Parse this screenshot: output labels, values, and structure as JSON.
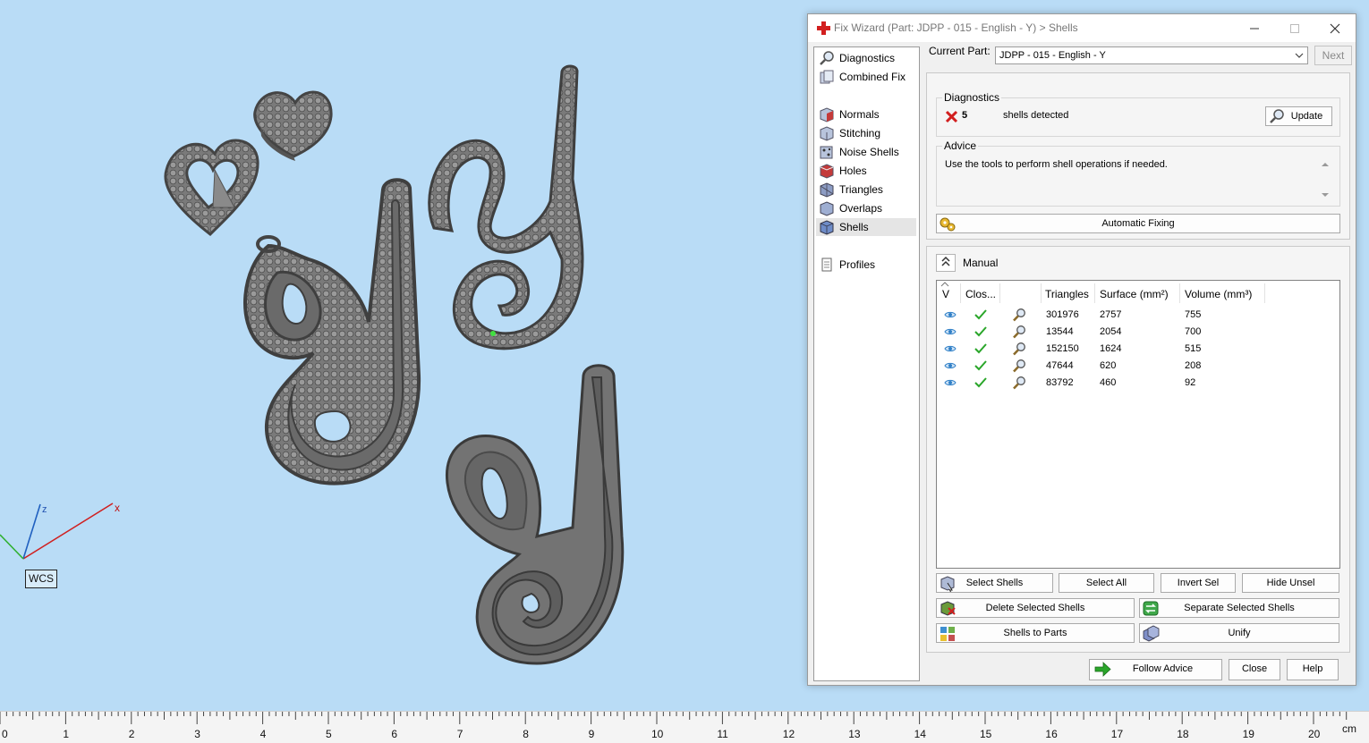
{
  "viewport": {
    "wcs_label": "WCS",
    "axis_x_label": "x",
    "axis_z_label": "z"
  },
  "ruler": {
    "ticks": [
      "0",
      "1",
      "2",
      "3",
      "4",
      "5",
      "6",
      "7",
      "8",
      "9",
      "10",
      "11",
      "12",
      "13",
      "14",
      "15",
      "16",
      "17",
      "18",
      "19",
      "20"
    ],
    "unit": "cm"
  },
  "dialog": {
    "title": "Fix Wizard (Part: JDPP - 015 - English - Y) > Shells",
    "nav": {
      "diagnostics": "Diagnostics",
      "combined_fix": "Combined Fix",
      "normals": "Normals",
      "stitching": "Stitching",
      "noise_shells": "Noise Shells",
      "holes": "Holes",
      "triangles": "Triangles",
      "overlaps": "Overlaps",
      "shells": "Shells",
      "profiles": "Profiles",
      "selected": "Shells"
    },
    "current_part_label": "Current Part:",
    "current_part_value": "JDPP - 015 - English - Y",
    "next_label": "Next",
    "diagnostics": {
      "title": "Diagnostics",
      "count": "5",
      "text": "shells detected",
      "update_label": "Update"
    },
    "advice": {
      "title": "Advice",
      "text": "Use the tools to perform shell operations if needed."
    },
    "automatic_fixing_label": "Automatic Fixing",
    "manual_label": "Manual",
    "table": {
      "headers": {
        "visible": "V",
        "closed": "Clos...",
        "triangles": "Triangles",
        "surface": "Surface (mm²)",
        "volume": "Volume (mm³)"
      },
      "rows": [
        {
          "triangles": "301976",
          "surface": "2757",
          "volume": "755"
        },
        {
          "triangles": "13544",
          "surface": "2054",
          "volume": "700"
        },
        {
          "triangles": "152150",
          "surface": "1624",
          "volume": "515"
        },
        {
          "triangles": "47644",
          "surface": "620",
          "volume": "208"
        },
        {
          "triangles": "83792",
          "surface": "460",
          "volume": "92"
        }
      ]
    },
    "buttons": {
      "select_shells": "Select Shells",
      "select_all": "Select All",
      "invert_sel": "Invert Sel",
      "hide_unsel": "Hide Unsel",
      "delete_selected_shells": "Delete Selected Shells",
      "separate_selected_shells": "Separate Selected Shells",
      "shells_to_parts": "Shells to Parts",
      "unify": "Unify",
      "follow_advice": "Follow Advice",
      "close": "Close",
      "help": "Help"
    },
    "colors": {
      "accent_red": "#d21f1f",
      "check_green": "#2aa62a",
      "eye_blue": "#2f7fc7",
      "viewport_bg": "#b9dcf6",
      "model_gray": "#6e6e6e"
    }
  }
}
